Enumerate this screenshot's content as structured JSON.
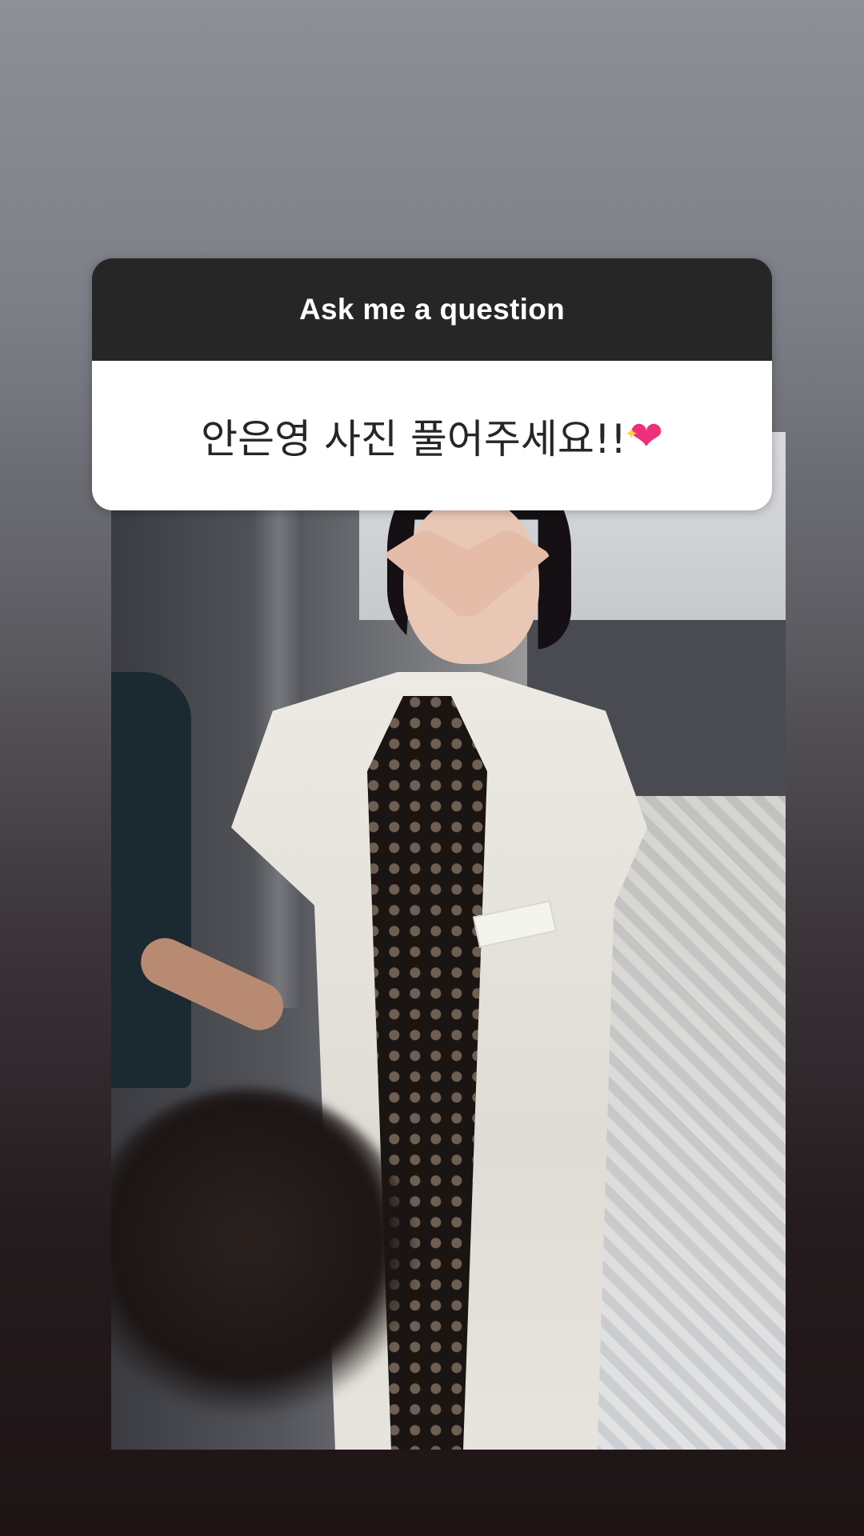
{
  "question_sticker": {
    "header": "Ask me a question",
    "answer_text": "안은영 사진 풀어주세요!!",
    "answer_emoji": "💖"
  },
  "colors": {
    "sticker_header_bg": "#262626",
    "sticker_body_bg": "#ffffff",
    "background_top": "#8e9098",
    "background_bottom": "#1e1416"
  },
  "icons": {
    "answer_emoji": "sparkling-heart-icon"
  }
}
